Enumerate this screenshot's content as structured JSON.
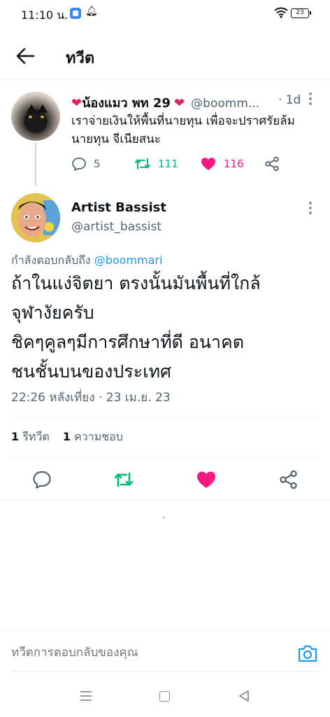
{
  "status_bar": {
    "time": "11:10 น.",
    "battery": "23",
    "icons": [
      "app-notification-icon",
      "bell-icon",
      "wifi-icon",
      "battery-icon"
    ]
  },
  "header": {
    "title": "ทวีต"
  },
  "parent_tweet": {
    "display_name": "น้องแมว พท 29",
    "name_emoji": "❤",
    "handle": "@boomm...",
    "time": "· 1d",
    "text": "เราจ่ายเงินให้พื้นที่นายทุน เพื่อจะปราศรัยล้มนายทุน จีเนียสนะ",
    "replies": "5",
    "retweets": "111",
    "likes": "116"
  },
  "main_tweet": {
    "display_name": "Artist Bassist",
    "handle": "@artist_bassist",
    "replying_prefix": "กำลังตอบกลับถึง",
    "replying_handle": "@boommari",
    "text_lines": [
      "ถ้าในแง่จิตยา ตรงนั้นมันพื้นที่ใกล้",
      "จุฬางัยครับ",
      "ชิคๆคูลๆมีการศึกษาที่ดี อนาคต",
      "ชนชั้นบนของประเทศ"
    ],
    "timestamp": "22:26 หลังเที่ยง · 23 เม.ย. 23",
    "retweet_count": "1",
    "retweet_label": "รีทวีต",
    "like_count": "1",
    "like_label": "ความชอบ"
  },
  "compose": {
    "placeholder": "ทวีตการตอบกลับของคุณ"
  },
  "colors": {
    "accent": "#1d9bf0",
    "retweet": "#00ba7c",
    "like": "#f91880",
    "secondary_text": "#536471"
  }
}
